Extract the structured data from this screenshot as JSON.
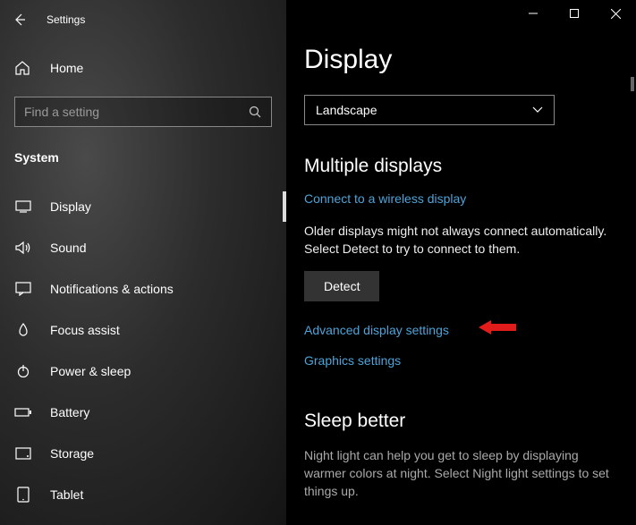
{
  "app": {
    "title": "Settings"
  },
  "sidebar": {
    "home_label": "Home",
    "search_placeholder": "Find a setting",
    "category": "System",
    "items": [
      {
        "label": "Display"
      },
      {
        "label": "Sound"
      },
      {
        "label": "Notifications & actions"
      },
      {
        "label": "Focus assist"
      },
      {
        "label": "Power & sleep"
      },
      {
        "label": "Battery"
      },
      {
        "label": "Storage"
      },
      {
        "label": "Tablet"
      }
    ]
  },
  "main": {
    "title": "Display",
    "orientation_selected": "Landscape",
    "multi_heading": "Multiple displays",
    "wireless_link": "Connect to a wireless display",
    "detect_hint": "Older displays might not always connect automatically. Select Detect to try to connect to them.",
    "detect_button": "Detect",
    "advanced_link": "Advanced display settings",
    "graphics_link": "Graphics settings",
    "sleep_heading": "Sleep better",
    "sleep_desc": "Night light can help you get to sleep by displaying warmer colors at night. Select Night light settings to set things up."
  }
}
